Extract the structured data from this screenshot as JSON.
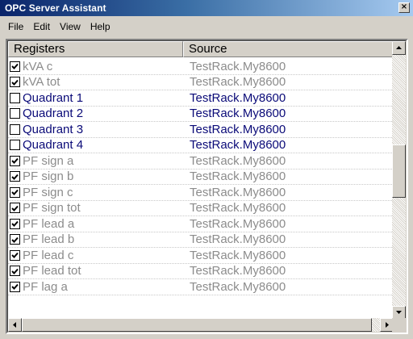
{
  "window": {
    "title": "OPC Server Assistant",
    "close_symbol": "×"
  },
  "menu": {
    "items": [
      "File",
      "Edit",
      "View",
      "Help"
    ]
  },
  "list": {
    "columns": [
      "Registers",
      "Source"
    ],
    "rows": [
      {
        "register": "kVA c",
        "source": "TestRack.My8600",
        "checked": true
      },
      {
        "register": "kVA tot",
        "source": "TestRack.My8600",
        "checked": true
      },
      {
        "register": "Quadrant 1",
        "source": "TestRack.My8600",
        "checked": false
      },
      {
        "register": "Quadrant 2",
        "source": "TestRack.My8600",
        "checked": false
      },
      {
        "register": "Quadrant 3",
        "source": "TestRack.My8600",
        "checked": false
      },
      {
        "register": "Quadrant 4",
        "source": "TestRack.My8600",
        "checked": false
      },
      {
        "register": "PF sign a",
        "source": "TestRack.My8600",
        "checked": true
      },
      {
        "register": "PF sign b",
        "source": "TestRack.My8600",
        "checked": true
      },
      {
        "register": "PF sign c",
        "source": "TestRack.My8600",
        "checked": true
      },
      {
        "register": "PF sign tot",
        "source": "TestRack.My8600",
        "checked": true
      },
      {
        "register": "PF lead a",
        "source": "TestRack.My8600",
        "checked": true
      },
      {
        "register": "PF lead b",
        "source": "TestRack.My8600",
        "checked": true
      },
      {
        "register": "PF lead c",
        "source": "TestRack.My8600",
        "checked": true
      },
      {
        "register": "PF lead tot",
        "source": "TestRack.My8600",
        "checked": true
      },
      {
        "register": "PF lag a",
        "source": "TestRack.My8600",
        "checked": true
      }
    ]
  },
  "colors": {
    "title_bar_start": "#0a246a",
    "title_bar_end": "#a6caf0",
    "unchecked_text": "#0a0a78",
    "checked_text": "#8c8c8c"
  }
}
